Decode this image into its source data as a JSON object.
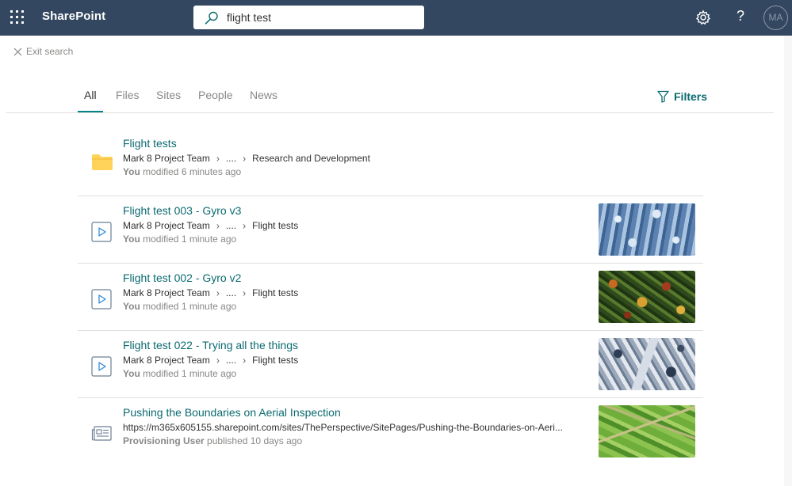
{
  "app": {
    "name": "SharePoint"
  },
  "search": {
    "query": "flight test"
  },
  "header": {
    "help_label": "?",
    "avatar_initials": "MA"
  },
  "exit_search": {
    "label": "Exit search"
  },
  "tabs": [
    {
      "label": "All",
      "active": true
    },
    {
      "label": "Files",
      "active": false
    },
    {
      "label": "Sites",
      "active": false
    },
    {
      "label": "People",
      "active": false
    },
    {
      "label": "News",
      "active": false
    }
  ],
  "filters": {
    "label": "Filters"
  },
  "results": [
    {
      "type": "folder",
      "icon": "folder-icon",
      "title": "Flight tests",
      "path": [
        "Mark 8 Project Team",
        "....",
        "Research and Development"
      ],
      "meta_actor": "You",
      "meta_text": "modified 6 minutes ago",
      "thumbnail": null
    },
    {
      "type": "video",
      "icon": "video-icon",
      "title": "Flight test 003 - Gyro v3",
      "path": [
        "Mark 8 Project Team",
        "....",
        "Flight tests"
      ],
      "meta_actor": "You",
      "meta_text": "modified 1 minute ago",
      "thumbnail": "snowy-forest"
    },
    {
      "type": "video",
      "icon": "video-icon",
      "title": "Flight test 002 - Gyro v2",
      "path": [
        "Mark 8 Project Team",
        "....",
        "Flight tests"
      ],
      "meta_actor": "You",
      "meta_text": "modified 1 minute ago",
      "thumbnail": "autumn-forest"
    },
    {
      "type": "video",
      "icon": "video-icon",
      "title": "Flight test 022 - Trying all the things",
      "path": [
        "Mark 8 Project Team",
        "....",
        "Flight tests"
      ],
      "meta_actor": "You",
      "meta_text": "modified 1 minute ago",
      "thumbnail": "aerial-snow"
    },
    {
      "type": "news",
      "icon": "news-icon",
      "title": "Pushing the Boundaries on Aerial Inspection",
      "url": "https://m365x605155.sharepoint.com/sites/ThePerspective/SitePages/Pushing-the-Boundaries-on-Aeri...",
      "meta_actor": "Provisioning User",
      "meta_text": "published 10 days ago",
      "thumbnail": "green-fields"
    }
  ],
  "colors": {
    "header_bg": "#344760",
    "accent": "#038387",
    "link": "#0b6a70",
    "folder": "#ffd35a"
  }
}
